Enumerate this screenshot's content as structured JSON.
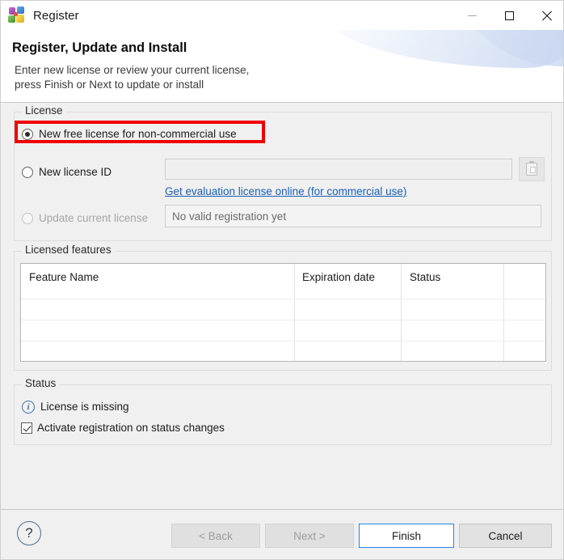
{
  "window": {
    "title": "Register",
    "icon": "app-balloons-icon",
    "controls": {
      "minimize": "minimize-icon",
      "maximize": "maximize-icon",
      "close": "close-icon"
    }
  },
  "banner": {
    "title": "Register, Update and Install",
    "description_line1": "Enter new license or review your current license,",
    "description_line2": "press Finish or Next to update or install"
  },
  "license_group": {
    "legend": "License",
    "options": [
      {
        "label": "New free license for non-commercial use",
        "selected": true,
        "enabled": true,
        "highlighted": true
      },
      {
        "label": "New license ID",
        "selected": false,
        "enabled": true,
        "highlighted": false
      },
      {
        "label": "Update current license",
        "selected": false,
        "enabled": false,
        "highlighted": false
      }
    ],
    "license_id_field": {
      "value": "",
      "placeholder": ""
    },
    "paste_button": "paste-clipboard-icon",
    "eval_link": "Get evaluation license online (for commercial use)",
    "current_license_field": {
      "value": "No valid registration yet"
    }
  },
  "features_group": {
    "legend": "Licensed features",
    "columns": [
      "Feature Name",
      "Expiration date",
      "Status",
      ""
    ],
    "rows": []
  },
  "status_group": {
    "legend": "Status",
    "info_icon": "info-icon",
    "message": "License is missing",
    "checkbox": {
      "label": "Activate registration on status changes",
      "checked": true
    }
  },
  "footer": {
    "help_button": "?",
    "buttons": [
      {
        "id": "back",
        "label": "< Back",
        "enabled": false,
        "default": false
      },
      {
        "id": "next",
        "label": "Next >",
        "enabled": false,
        "default": false
      },
      {
        "id": "finish",
        "label": "Finish",
        "enabled": true,
        "default": true
      },
      {
        "id": "cancel",
        "label": "Cancel",
        "enabled": true,
        "default": false
      }
    ]
  },
  "colors": {
    "highlight_box": "#ee0000",
    "link": "#1a5fb4",
    "default_button_border": "#1f86e8",
    "dialog_background": "#f0f0f0",
    "banner_background": "#ffffff"
  }
}
